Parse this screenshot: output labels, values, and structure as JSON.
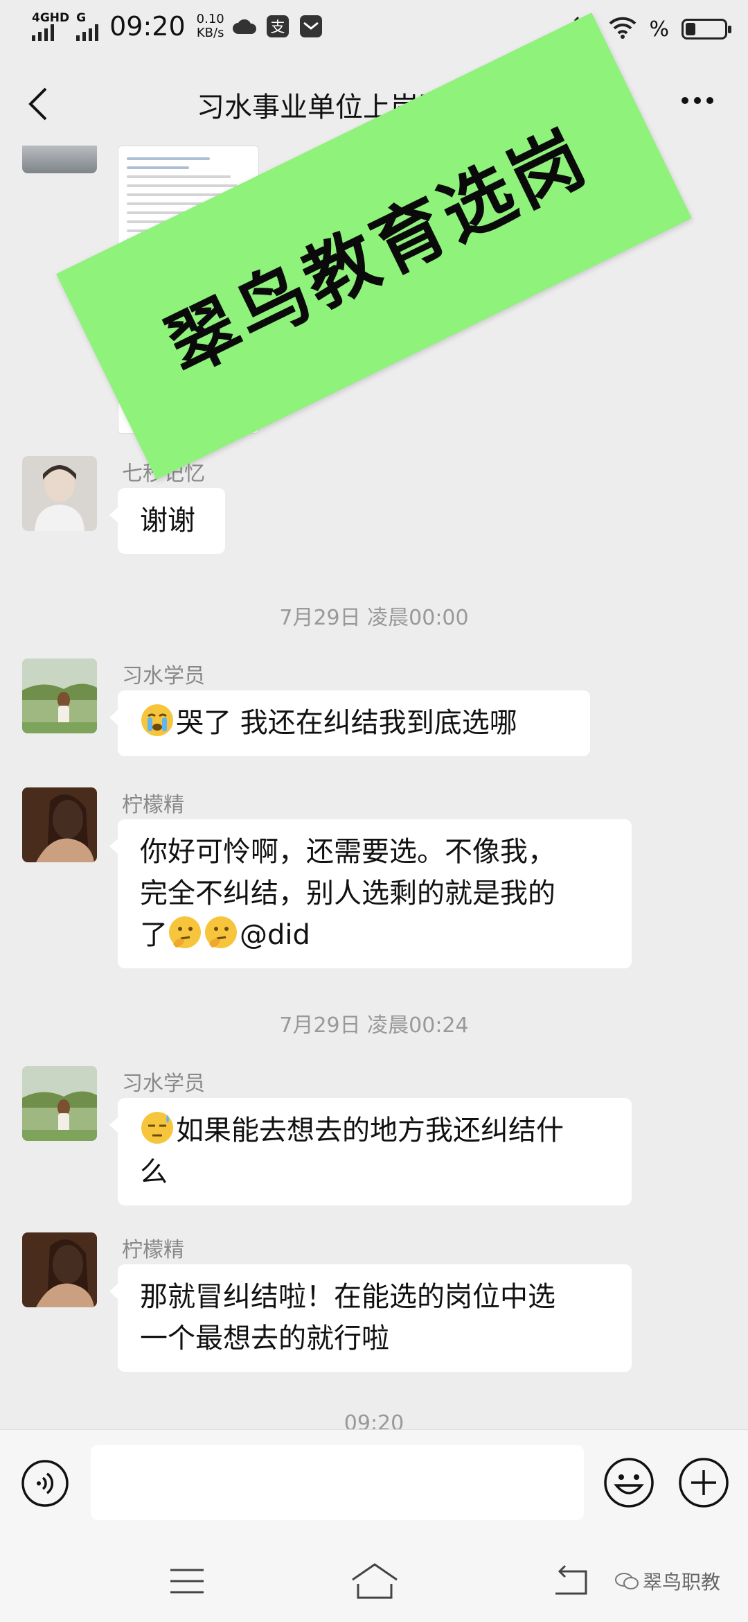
{
  "status_bar": {
    "signal1": "4GHD",
    "signal2": "G",
    "time": "09:20",
    "speed_value": "0.10",
    "speed_unit": "KB/s",
    "battery_pct_text": "%",
    "icons": [
      "cloud-icon",
      "alipay-icon",
      "message-icon",
      "alarm-icon",
      "wifi-icon",
      "battery-icon"
    ]
  },
  "header": {
    "title": "习水事业单位上岸群",
    "back_icon": "chevron-left-icon",
    "more_icon": "more-icon"
  },
  "overlay": {
    "text": "翠鸟教育选岗"
  },
  "messages": [
    {
      "sender": "七秒记忆",
      "text": "谢谢"
    },
    {
      "time": "7月29日 凌晨00:00"
    },
    {
      "sender": "习水学员",
      "emoji": "crying-face",
      "text": "哭了 我还在纠结我到底选哪"
    },
    {
      "sender": "柠檬精",
      "line1": "你好可怜啊，还需要选。不像我，",
      "line2": "完全不纠结，别人选剩的就是我的",
      "line3_prefix": "了",
      "emoji": "thinking-face",
      "mention": "@did"
    },
    {
      "time": "7月29日 凌晨00:24"
    },
    {
      "sender": "习水学员",
      "emoji": "sweat-face",
      "line1": "如果能去想去的地方我还纠结什",
      "line2": "么"
    },
    {
      "sender": "柠檬精",
      "line1": "那就冒纠结啦！在能选的岗位中选",
      "line2": "一个最想去的就行啦"
    },
    {
      "time": "09:20"
    }
  ],
  "input_bar": {
    "voice_icon": "voice-icon",
    "placeholder": "",
    "emoji_icon": "smiley-icon",
    "plus_icon": "plus-icon"
  },
  "nav_bar": {
    "menu_icon": "menu-icon",
    "home_icon": "home-icon",
    "back_icon": "back-icon",
    "watermark": "翠鸟职教"
  },
  "colors": {
    "background": "#ededed",
    "bubble": "#ffffff",
    "overlay": "#8ef27b",
    "sender_text": "#888888"
  }
}
